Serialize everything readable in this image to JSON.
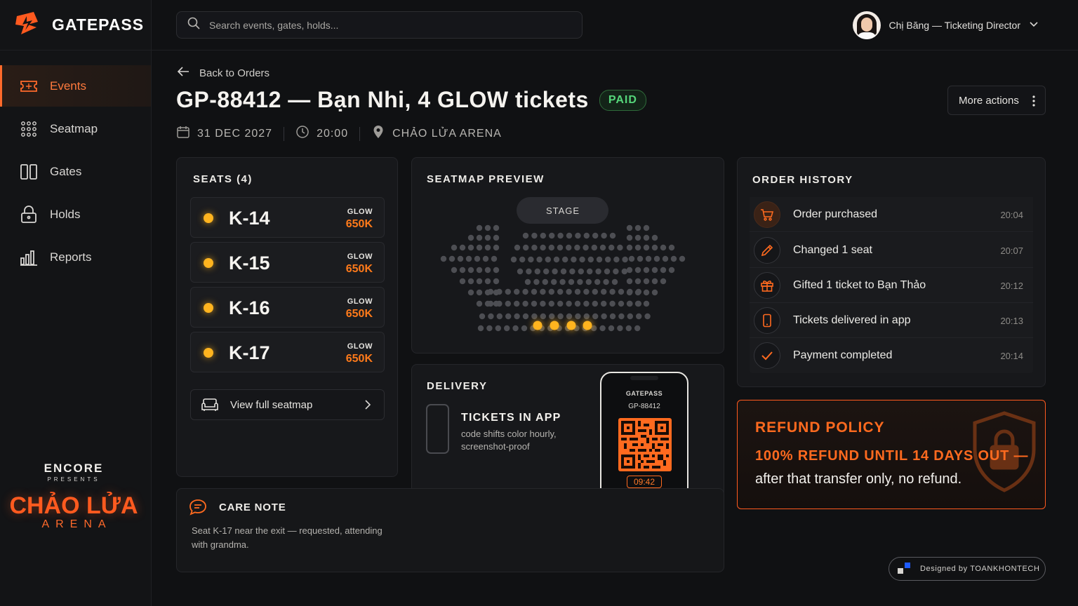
{
  "brand": {
    "name": "GATEPASS"
  },
  "nav": {
    "items": [
      {
        "label": "Events",
        "icon": "ticket-icon",
        "active": true
      },
      {
        "label": "Seatmap",
        "icon": "grid-dots-icon",
        "active": false
      },
      {
        "label": "Gates",
        "icon": "gate-icon",
        "active": false
      },
      {
        "label": "Holds",
        "icon": "lock-icon",
        "active": false
      },
      {
        "label": "Reports",
        "icon": "bar-chart-icon",
        "active": false
      }
    ]
  },
  "venue": {
    "line1": "ENCORE",
    "line2": "PRESENTS",
    "line3": "CHẢO LỬA",
    "line4": "ARENA"
  },
  "search": {
    "placeholder": "Search events, gates, holds..."
  },
  "user": {
    "name": "Chị Băng — Ticketing Director"
  },
  "header": {
    "back_label": "Back to Orders",
    "title": "GP-88412 — Bạn Nhi, 4 GLOW tickets",
    "status": "PAID",
    "more_actions": "More actions",
    "date": "31 DEC 2027",
    "time": "20:00",
    "venue": "CHẢO LỬA ARENA"
  },
  "seats": {
    "title": "SEATS (4)",
    "items": [
      {
        "code": "K-14",
        "tier": "GLOW",
        "price": "650K"
      },
      {
        "code": "K-15",
        "tier": "GLOW",
        "price": "650K"
      },
      {
        "code": "K-16",
        "tier": "GLOW",
        "price": "650K"
      },
      {
        "code": "K-17",
        "tier": "GLOW",
        "price": "650K"
      }
    ],
    "view_full": "View full seatmap"
  },
  "seatmap": {
    "title": "SEATMAP PREVIEW",
    "stage_label": "STAGE"
  },
  "delivery": {
    "title": "DELIVERY",
    "method": "TICKETS IN APP",
    "description": "code shifts color hourly, screenshot-proof",
    "phone_brand": "GATEPASS",
    "phone_code": "GP-88412",
    "timer": "09:42"
  },
  "care_note": {
    "title": "CARE NOTE",
    "text": "Seat K-17 near the exit — requested, attending with grandma."
  },
  "history": {
    "title": "ORDER HISTORY",
    "items": [
      {
        "label": "Order purchased",
        "time": "20:04",
        "icon": "cart-icon"
      },
      {
        "label": "Changed 1 seat",
        "time": "20:07",
        "icon": "pencil-icon"
      },
      {
        "label": "Gifted 1 ticket to Bạn Thảo",
        "time": "20:12",
        "icon": "gift-icon"
      },
      {
        "label": "Tickets delivered in app",
        "time": "20:13",
        "icon": "phone-icon"
      },
      {
        "label": "Payment completed",
        "time": "20:14",
        "icon": "check-icon"
      }
    ]
  },
  "refund": {
    "title": "REFUND POLICY",
    "line1": "100% REFUND UNTIL 14 DAYS OUT —",
    "line2": "after that transfer only, no refund."
  },
  "credit": {
    "text": "Designed by TOANKHONTECH"
  },
  "colors": {
    "accent": "#ff6a1f",
    "paid": "#55d67a",
    "seat_glow": "#ffb41f",
    "background": "#101113"
  }
}
